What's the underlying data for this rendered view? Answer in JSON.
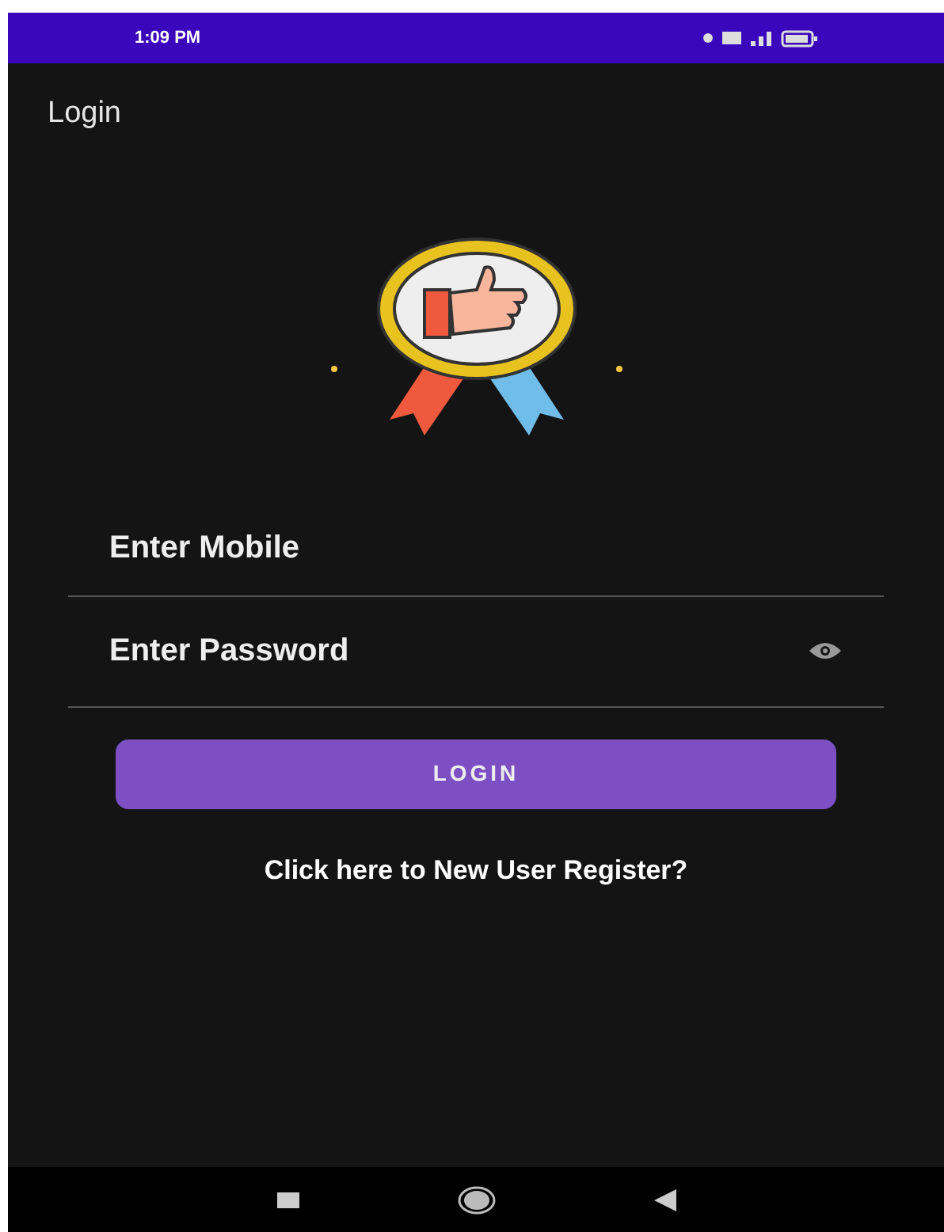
{
  "status_bar": {
    "time": "1:09 PM"
  },
  "app_bar": {
    "title": "Login"
  },
  "form": {
    "mobile": {
      "placeholder": "Enter Mobile"
    },
    "password": {
      "placeholder": "Enter Password"
    },
    "login_button": "LOGIN",
    "register_link": "Click here to New User Register?"
  }
}
